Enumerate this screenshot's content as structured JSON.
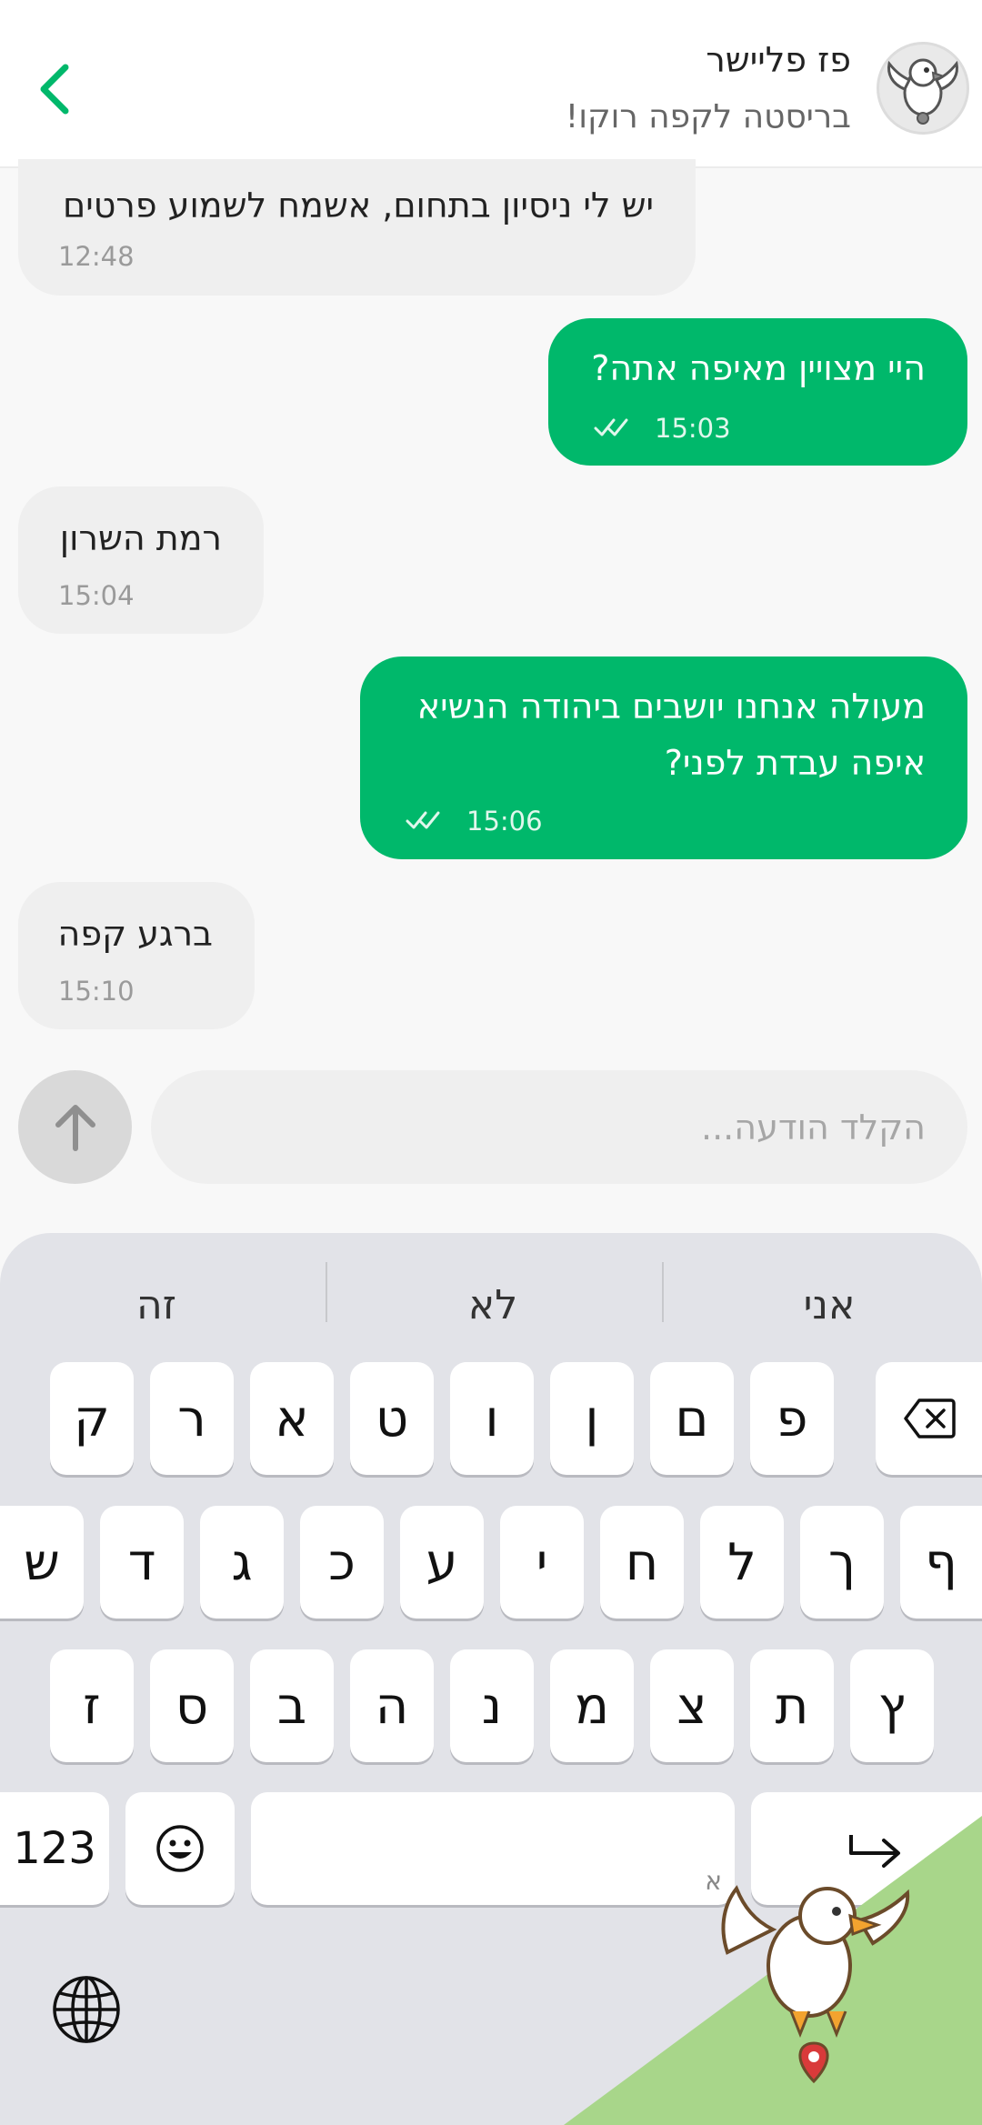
{
  "header": {
    "contact_name": "פז פליישר",
    "contact_status": "בריסטה לקפה רוקו!",
    "back_icon": "chevron-left-icon",
    "avatar_icon": "eagle-mascot-icon"
  },
  "messages": [
    {
      "direction": "in",
      "text": "יש לי ניסיון בתחום, אשמח לשמוע פרטים",
      "time": "12:48"
    },
    {
      "direction": "out",
      "text": "היי מצויין מאיפה אתה?",
      "time": "15:03",
      "status_icon": "double-check-icon"
    },
    {
      "direction": "in",
      "text": "רמת השרון",
      "time": "15:04"
    },
    {
      "direction": "out",
      "text_line1": "מעולה אנחנו יושבים ביהודה הנשיא",
      "text_line2": "איפה עבדת לפני?",
      "time": "15:06",
      "status_icon": "double-check-icon"
    },
    {
      "direction": "in",
      "text": "ברגע קפה",
      "time": "15:10"
    }
  ],
  "composer": {
    "placeholder": "הקלד הודעה...",
    "value": "",
    "send_icon": "arrow-up-icon"
  },
  "keyboard": {
    "suggestions": [
      "אני",
      "לא",
      "זה"
    ],
    "row1": [
      "ק",
      "ר",
      "א",
      "ט",
      "ו",
      "ן",
      "ם",
      "פ"
    ],
    "row2": [
      "ש",
      "ד",
      "ג",
      "כ",
      "ע",
      "י",
      "ח",
      "ל",
      "ך",
      "ף"
    ],
    "row3": [
      "ז",
      "ס",
      "ב",
      "ה",
      "נ",
      "מ",
      "צ",
      "ת",
      "ץ"
    ],
    "numbers_label": "123",
    "space_hint": "א",
    "backspace_icon": "backspace-icon",
    "emoji_icon": "smiley-icon",
    "return_icon": "return-arrow-icon",
    "globe_icon": "globe-icon"
  },
  "colors": {
    "accent_green": "#00b86b",
    "incoming_bubble": "#efefef",
    "keyboard_bg": "#e2e3e8",
    "mascot_corner": "#a8d68a"
  }
}
